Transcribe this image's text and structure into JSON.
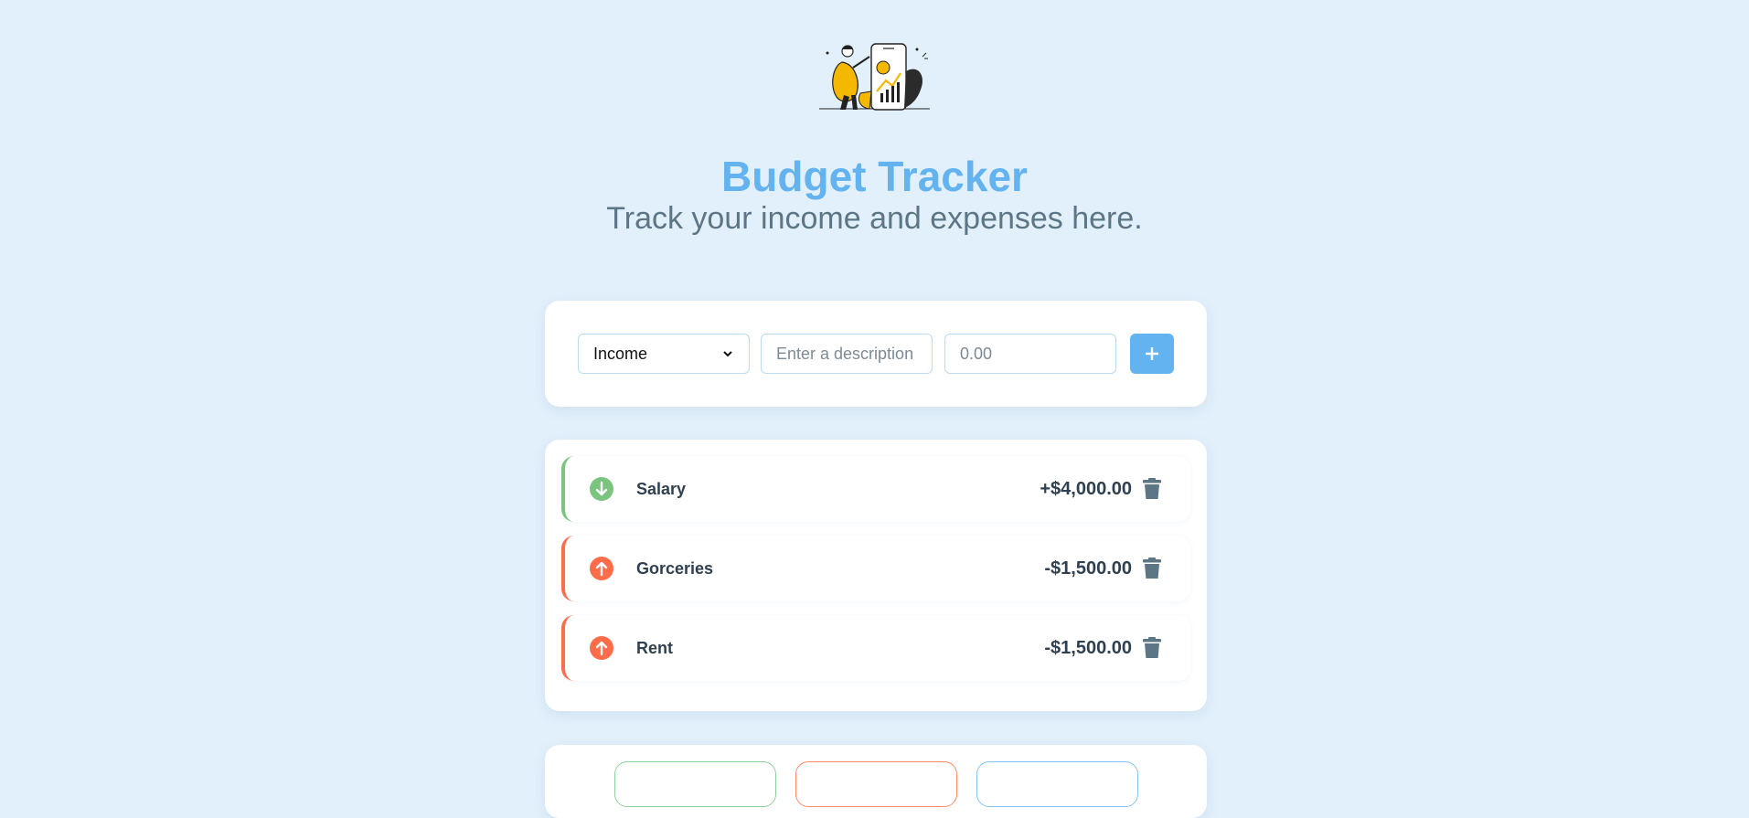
{
  "header": {
    "title": "Budget Tracker",
    "subtitle": "Track your income and expenses here."
  },
  "form": {
    "type_options": [
      "Income"
    ],
    "type_selected": "Income",
    "description_placeholder": "Enter a description",
    "amount_placeholder": "0.00",
    "add_icon": "plus-icon"
  },
  "transactions": [
    {
      "type": "income",
      "icon": "arrow-down-circle-icon",
      "description": "Salary",
      "amount": "+$4,000.00"
    },
    {
      "type": "expense",
      "icon": "arrow-up-circle-icon",
      "description": "Gorceries",
      "amount": "-$1,500.00"
    },
    {
      "type": "expense",
      "icon": "arrow-up-circle-icon",
      "description": "Rent",
      "amount": "-$1,500.00"
    }
  ],
  "colors": {
    "accent": "#62b3f0",
    "income": "#7bc47f",
    "expense": "#ff6c4a",
    "background": "#e2f0fb",
    "text": "#2f4050",
    "trash": "#5c7686"
  }
}
